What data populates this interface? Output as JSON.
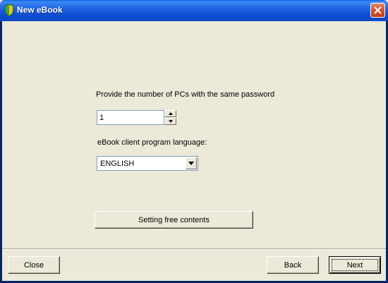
{
  "window": {
    "title": "New eBook",
    "accent_color": "#0F4FD2",
    "close_icon": "close-icon"
  },
  "form": {
    "pcs_label": "Provide the number of PCs with the same password",
    "pcs_value": "1",
    "language_label": "eBook client program language:",
    "language_selected": "ENGLISH",
    "free_contents_button": "Setting free contents"
  },
  "footer": {
    "close_button": "Close",
    "back_button": "Back",
    "next_button": "Next"
  }
}
